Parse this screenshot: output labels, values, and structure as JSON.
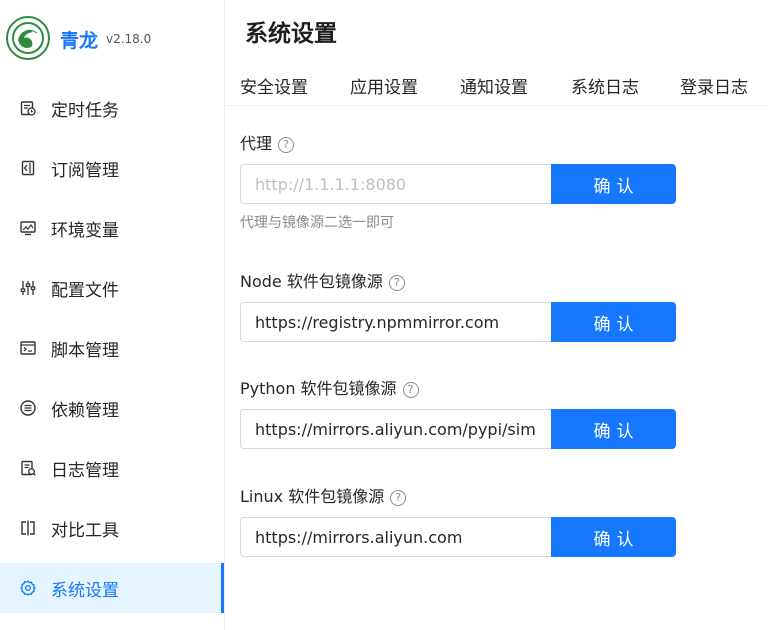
{
  "brand": {
    "name": "青龙",
    "version": "v2.18.0",
    "logo_icon": "dragon-logo-icon"
  },
  "sidebar": {
    "items": [
      {
        "label": "定时任务",
        "icon": "schedule-icon"
      },
      {
        "label": "订阅管理",
        "icon": "subscription-icon"
      },
      {
        "label": "环境变量",
        "icon": "environment-icon"
      },
      {
        "label": "配置文件",
        "icon": "config-sliders-icon"
      },
      {
        "label": "脚本管理",
        "icon": "script-icon"
      },
      {
        "label": "依赖管理",
        "icon": "dependency-icon"
      },
      {
        "label": "日志管理",
        "icon": "log-icon"
      },
      {
        "label": "对比工具",
        "icon": "diff-icon"
      },
      {
        "label": "系统设置",
        "icon": "gear-icon",
        "active": true
      }
    ]
  },
  "main": {
    "title": "系统设置",
    "tabs": [
      "安全设置",
      "应用设置",
      "通知设置",
      "系统日志",
      "登录日志"
    ],
    "fields": [
      {
        "label": "代理",
        "value": "",
        "placeholder": "http://1.1.1.1:8080",
        "hint": "代理与镜像源二选一即可",
        "button": "确认"
      },
      {
        "label": "Node 软件包镜像源",
        "value": "https://registry.npmmirror.com",
        "placeholder": "",
        "button": "确认"
      },
      {
        "label": "Python 软件包镜像源",
        "value": "https://mirrors.aliyun.com/pypi/simp",
        "placeholder": "",
        "button": "确认"
      },
      {
        "label": "Linux 软件包镜像源",
        "value": "https://mirrors.aliyun.com",
        "placeholder": "",
        "button": "确认"
      }
    ]
  },
  "colors": {
    "accent": "#1677ff",
    "active_bg": "#e6f4ff",
    "text": "#262626",
    "muted": "#8c8c8c"
  }
}
